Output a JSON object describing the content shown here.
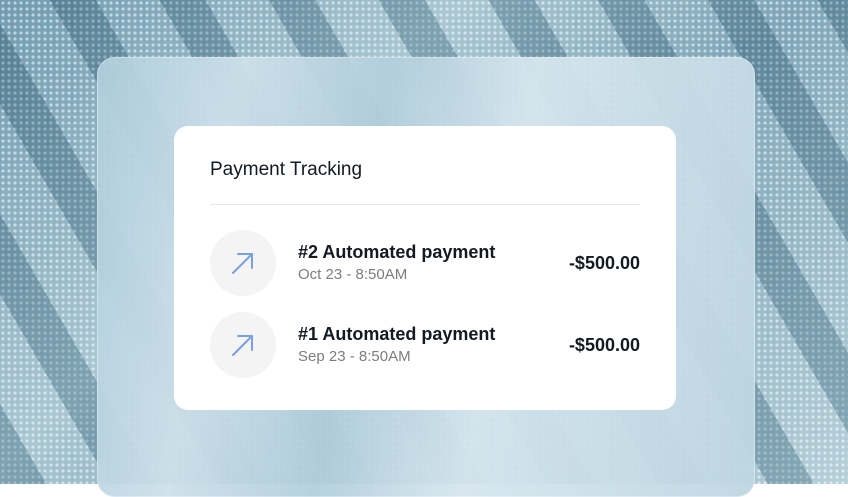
{
  "card": {
    "title": "Payment Tracking"
  },
  "payments": [
    {
      "title": "#2 Automated payment",
      "date": "Oct 23 - 8:50AM",
      "amount": "-$500.00",
      "icon": "arrow-up-right-icon"
    },
    {
      "title": "#1 Automated payment",
      "date": "Sep 23 - 8:50AM",
      "amount": "-$500.00",
      "icon": "arrow-up-right-icon"
    }
  ],
  "colors": {
    "accent": "#7aa0e0",
    "text_primary": "#131a22",
    "text_secondary": "#7b7d80",
    "card_bg": "#ffffff"
  }
}
